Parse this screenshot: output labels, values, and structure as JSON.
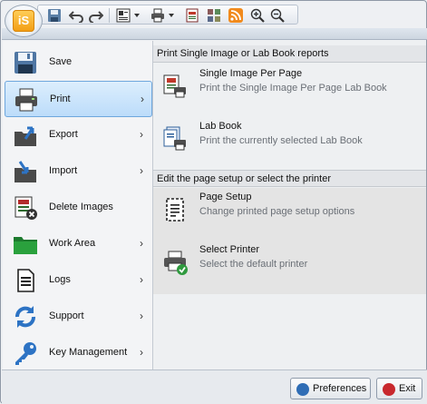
{
  "app": {
    "logo_text": "iS",
    "brand_color": "#f29c11"
  },
  "toolbar": {
    "icons": [
      "save-icon",
      "undo-icon",
      "redo-icon",
      "layout-icon",
      "print-icon",
      "report-icon",
      "grid-icon",
      "rss-icon",
      "zoom-in-icon",
      "zoom-out-icon"
    ]
  },
  "menu": {
    "items": [
      {
        "label": "Save",
        "icon": "save-icon",
        "submenu": false,
        "selected": false
      },
      {
        "label": "Print",
        "icon": "print-icon",
        "submenu": true,
        "selected": true,
        "chevron": "›"
      },
      {
        "label": "Export",
        "icon": "export-icon",
        "submenu": true,
        "selected": false,
        "chevron": "›"
      },
      {
        "label": "Import",
        "icon": "import-icon",
        "submenu": true,
        "selected": false,
        "chevron": "›"
      },
      {
        "label": "Delete Images",
        "icon": "delete-images-icon",
        "submenu": false,
        "selected": false
      },
      {
        "label": "Work Area",
        "icon": "folder-icon",
        "submenu": true,
        "selected": false,
        "chevron": "›"
      },
      {
        "label": "Logs",
        "icon": "logs-icon",
        "submenu": true,
        "selected": false,
        "chevron": "›"
      },
      {
        "label": "Support",
        "icon": "support-icon",
        "submenu": true,
        "selected": false,
        "chevron": "›"
      },
      {
        "label": "Key Management",
        "icon": "key-icon",
        "submenu": true,
        "selected": false,
        "chevron": "›"
      }
    ]
  },
  "panel": {
    "section1": {
      "header": "Print Single Image or Lab Book reports",
      "items": [
        {
          "title": "Single Image Per Page",
          "desc": "Print the Single Image Per Page Lab Book"
        },
        {
          "title": "Lab Book",
          "desc": "Print the currently selected Lab Book"
        }
      ]
    },
    "section2": {
      "header": "Edit the page setup or select the printer",
      "items": [
        {
          "title": "Page Setup",
          "desc": "Change printed page setup options"
        },
        {
          "title": "Select Printer",
          "desc": "Select the default printer"
        }
      ]
    }
  },
  "footer": {
    "preferences_label": "Preferences",
    "exit_label": "Exit"
  },
  "colors": {
    "selection": "#bcdcfa",
    "selection_border": "#6fa7dd",
    "exit_red": "#c8282d",
    "pref_blue": "#2f6db5"
  }
}
